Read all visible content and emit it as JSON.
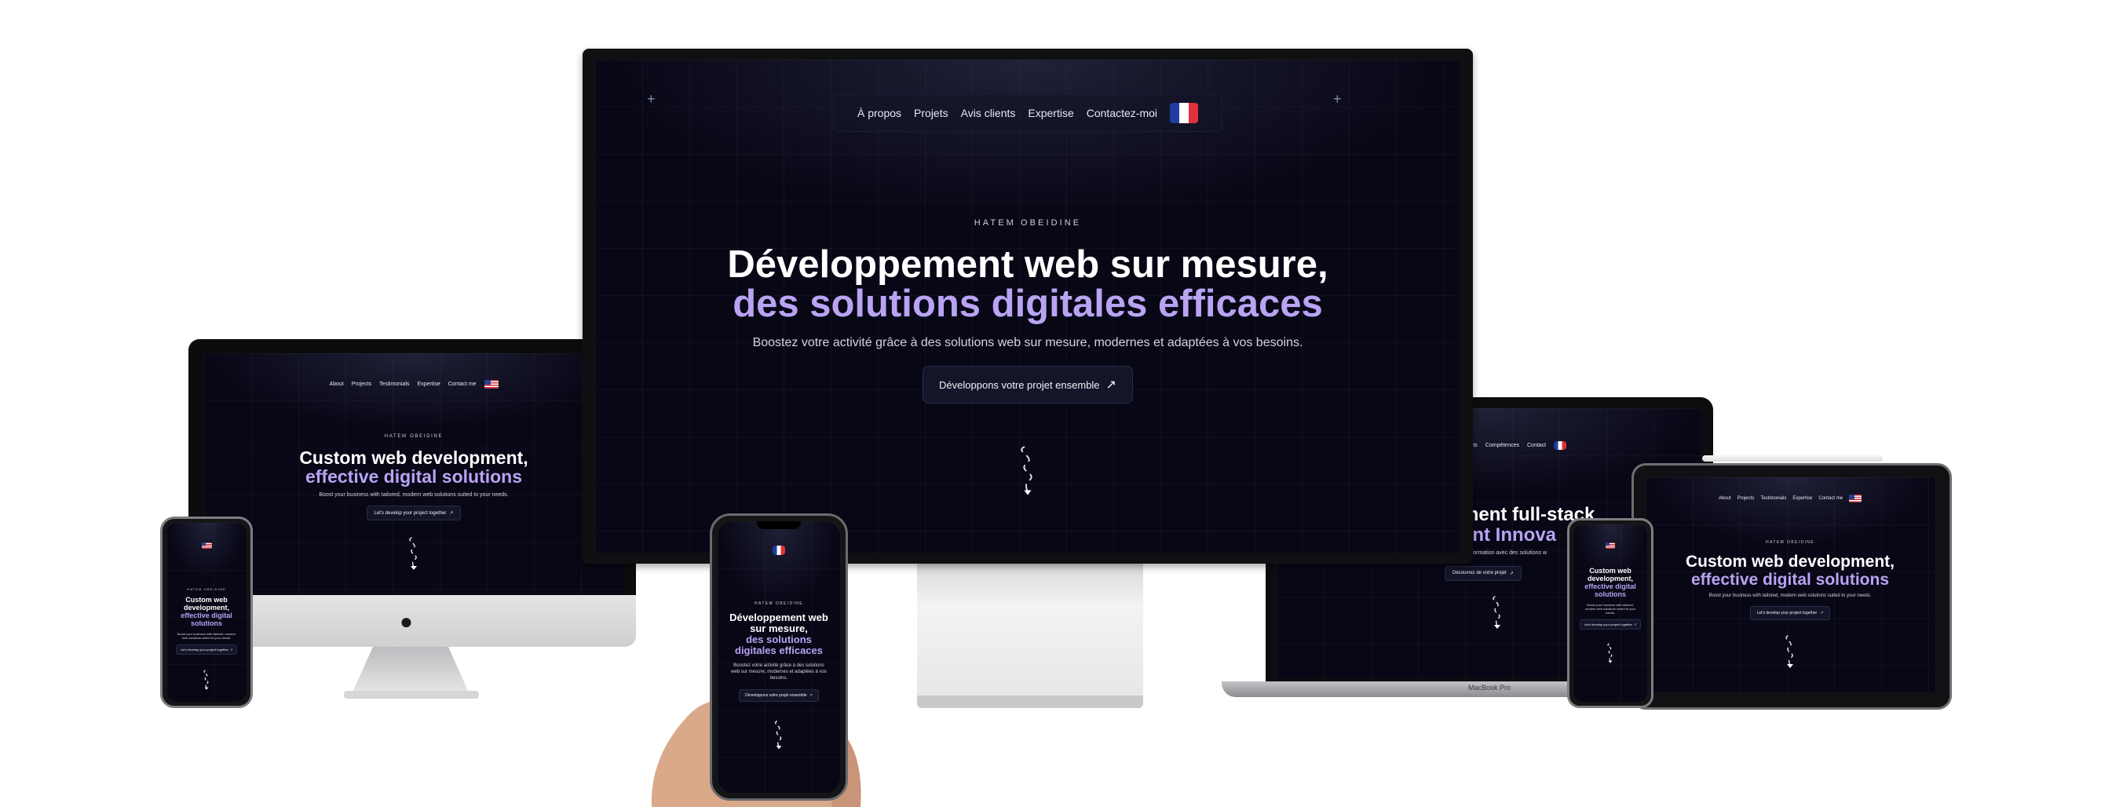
{
  "colors": {
    "screen_bg": "#070716",
    "accent": "#b9a3f2",
    "white": "#ffffff"
  },
  "big_display": {
    "nav": {
      "items": [
        "À propos",
        "Projets",
        "Avis clients",
        "Expertise",
        "Contactez-moi"
      ],
      "flag": "fr-flag"
    },
    "kicker": "HATEM OBEIDINE",
    "title_line1": "Développement web sur mesure,",
    "title_line2": "des solutions digitales efficaces",
    "subtitle": "Boostez votre activité grâce à des solutions web sur mesure, modernes et adaptées à vos besoins.",
    "cta": "Développons votre projet ensemble",
    "cta_icon": "arrow-up-right-icon"
  },
  "imac": {
    "nav": {
      "items": [
        "About",
        "Projects",
        "Testimonials",
        "Expertise",
        "Contact me"
      ],
      "flag": "us-flag"
    },
    "kicker": "HATEM OBEIDINE",
    "title_line1": "Custom web development,",
    "title_line2": "effective digital solutions",
    "subtitle": "Boost your business with tailored, modern web solutions suited to your needs.",
    "cta": "Let's develop your project together"
  },
  "phone_left": {
    "kicker": "HATEM OBEIDINE",
    "title_line1": "Custom web development,",
    "title_line2": "effective digital solutions",
    "subtitle": "Boost your business with tailored, modern web solutions suited to your needs.",
    "cta": "Let's develop your project together"
  },
  "phone_center": {
    "kicker": "HATEM OBEIDINE",
    "title_line1": "Développement web sur mesure,",
    "title_line2": "des solutions digitales efficaces",
    "subtitle": "Boostez votre activité grâce à des solutions web sur mesure, modernes et adaptées à vos besoins.",
    "cta": "Développons votre projet ensemble"
  },
  "laptop": {
    "nav": {
      "items": [
        "Projets",
        "Compétences",
        "Contact"
      ],
      "flag": "fr-flag"
    },
    "title_line1": "ment full-stack",
    "title_line2": "ent Innova",
    "subtitle": "Je vous accompagne dans votre transformation avec des solutions w",
    "cta": "Découvrez de votre projet",
    "brand": "MacBook Pro"
  },
  "phone_right": {
    "title_line1": "Custom web development,",
    "title_line2": "effective digital solutions",
    "subtitle": "Boost your business with tailored, modern web solutions suited to your needs.",
    "cta": "Let's develop your project together"
  },
  "tablet": {
    "nav": {
      "items": [
        "About",
        "Projects",
        "Testimonials",
        "Expertise",
        "Contact me"
      ],
      "flag": "us-flag"
    },
    "kicker": "HATEM OBEIDINE",
    "title_line1": "Custom web development,",
    "title_line2": "effective digital solutions",
    "subtitle": "Boost your business with tailored, modern web solutions suited to your needs.",
    "cta": "Let's develop your project together"
  }
}
